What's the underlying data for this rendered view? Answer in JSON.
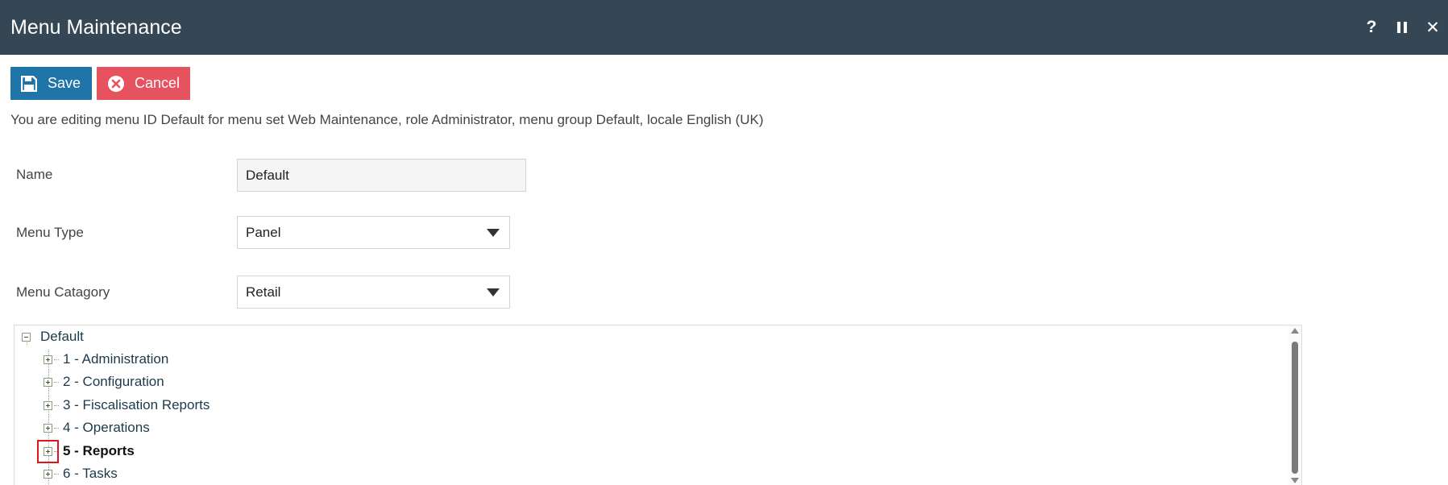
{
  "window": {
    "title": "Menu Maintenance",
    "controls": {
      "help": "?",
      "close": "✕"
    }
  },
  "toolbar": {
    "save_label": "Save",
    "cancel_label": "Cancel"
  },
  "info_text": "You are editing menu ID Default for menu set Web Maintenance, role Administrator, menu group Default, locale English (UK)",
  "form": {
    "name": {
      "label": "Name",
      "value": "Default"
    },
    "menu_type": {
      "label": "Menu Type",
      "value": "Panel"
    },
    "menu_category": {
      "label": "Menu Catagory",
      "value": "Retail"
    }
  },
  "tree": {
    "root": "Default",
    "items": [
      {
        "label": "1 - Administration"
      },
      {
        "label": "2 - Configuration"
      },
      {
        "label": "3 - Fiscalisation Reports"
      },
      {
        "label": "4 - Operations"
      },
      {
        "label": "5 - Reports",
        "selected": true
      },
      {
        "label": "6 - Tasks"
      }
    ]
  },
  "colors": {
    "titlebar": "#354655",
    "save": "#1f74a8",
    "cancel": "#e6525e",
    "highlight": "#e0141e"
  }
}
